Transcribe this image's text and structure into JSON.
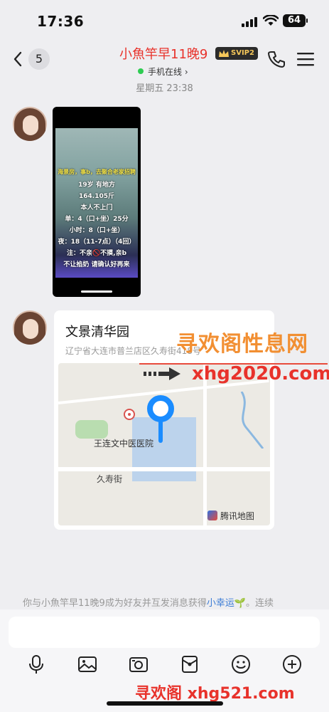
{
  "status_bar": {
    "time": "17:36",
    "battery": "64"
  },
  "header": {
    "back_count": "5",
    "title": "小魚竿早11晚9",
    "vip_badge": "SVIP2",
    "online_status": "手机在线 ›",
    "accent_color": "#e8322b"
  },
  "timestamp": "星期五 23:38",
  "video_message": {
    "overlay_lines": [
      "海景房，事b，去聚合老家招聘",
      "19岁  有地方",
      "164.105斤",
      "本人不上门",
      "单：4（口+坐）25分",
      "小时：8（口+坐）",
      "夜：18（11-7点）（4回）",
      "注：不亲🚫不摸,亲b",
      "不让掐奶 请确认好再来"
    ]
  },
  "location_message": {
    "name": "文景清华园",
    "address": "辽宁省大连市普兰店区久寿街418号",
    "map_labels": {
      "hospital": "王连文中医医院",
      "street": "久寿街",
      "provider": "腾讯地图"
    }
  },
  "watermarks": {
    "line1": "寻欢阁性息网",
    "line2": "xhg2020.com",
    "bottom": "寻欢阁 xhg521.com"
  },
  "system_message": {
    "text_before": "你与小魚竿早11晚9成为好友并互发消息获得",
    "highlight": "小幸运",
    "text_after": "🌱。连续"
  },
  "composer": {
    "placeholder": "",
    "tools": [
      "microphone-icon",
      "image-icon",
      "camera-icon",
      "red-packet-icon",
      "emoji-icon",
      "plus-icon"
    ]
  }
}
